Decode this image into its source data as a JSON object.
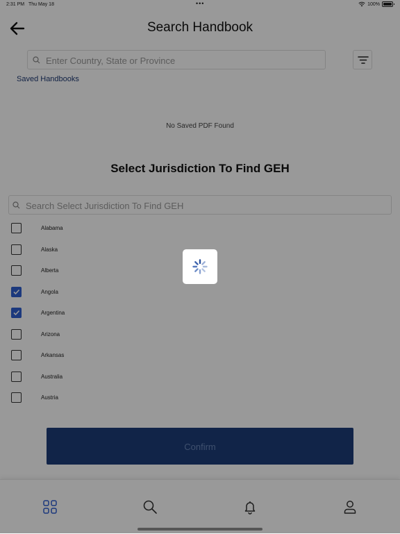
{
  "status_bar": {
    "time": "2:31 PM",
    "date": "Thu May 18",
    "multitask_dots": "•••",
    "battery": "100%"
  },
  "header": {
    "back_icon": "arrow-left-icon",
    "title": "Search Handbook"
  },
  "top_search": {
    "placeholder": "Enter Country, State or Province",
    "value": ""
  },
  "filter_icon": "filter-lines-icon",
  "saved_section": {
    "label": "Saved Handbooks",
    "empty_text": "No Saved PDF Found"
  },
  "jurisdiction": {
    "title": "Select Jurisdiction To Find GEH",
    "search_placeholder": "Search Select Jurisdiction To Find GEH",
    "items": [
      {
        "label": "Alabama",
        "checked": false
      },
      {
        "label": "Alaska",
        "checked": false
      },
      {
        "label": "Alberta",
        "checked": false
      },
      {
        "label": "Angola",
        "checked": true
      },
      {
        "label": "Argentina",
        "checked": true
      },
      {
        "label": "Arizona",
        "checked": false
      },
      {
        "label": "Arkansas",
        "checked": false
      },
      {
        "label": "Australia",
        "checked": false
      },
      {
        "label": "Austria",
        "checked": false
      }
    ]
  },
  "confirm_label": "Confirm",
  "tabbar": {
    "tabs": [
      {
        "icon": "grid-icon",
        "active": true
      },
      {
        "icon": "search-icon",
        "active": false
      },
      {
        "icon": "bell-icon",
        "active": false
      },
      {
        "icon": "user-icon",
        "active": false
      }
    ]
  },
  "loading": {
    "visible": true,
    "icon": "spinner-icon"
  },
  "colors": {
    "accent": "#2f5fd0",
    "confirm_bg": "#1d3d78",
    "saved_label": "#1f3a73"
  }
}
